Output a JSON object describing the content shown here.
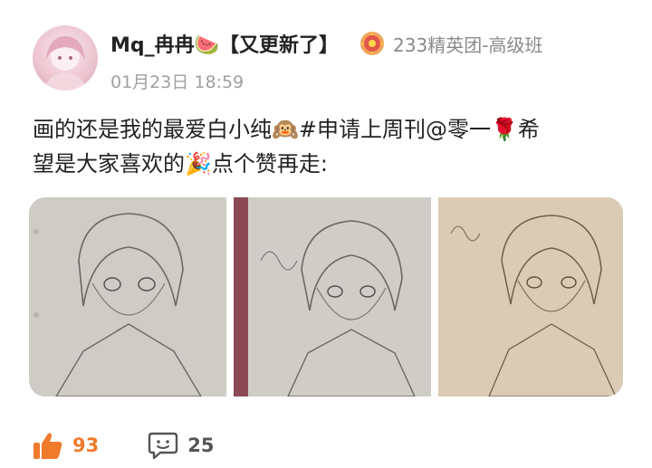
{
  "header": {
    "username": "Mq_冉冉🍉【又更新了】",
    "flair_label": "233精英团-高级班",
    "date": "01月23日 18:59"
  },
  "post": {
    "line1": "画的还是我的最爱白小纯🙉#申请上周刊@零一🌹希",
    "line2": "望是大家喜欢的🎉点个赞再走:"
  },
  "images": [
    {
      "name": "sketch-photo-1",
      "tone": "#c9c6c1"
    },
    {
      "name": "sketch-photo-2",
      "tone": "#cbc8c2"
    },
    {
      "name": "sketch-photo-3",
      "tone": "#d8c8b2"
    }
  ],
  "actions": {
    "like_count": "93",
    "comment_count": "25"
  },
  "colors": {
    "accent": "#f07a2c",
    "muted": "#8a8a8a"
  },
  "icons": [
    "flair-badge-icon",
    "thumbs-up-icon",
    "comment-icon"
  ]
}
